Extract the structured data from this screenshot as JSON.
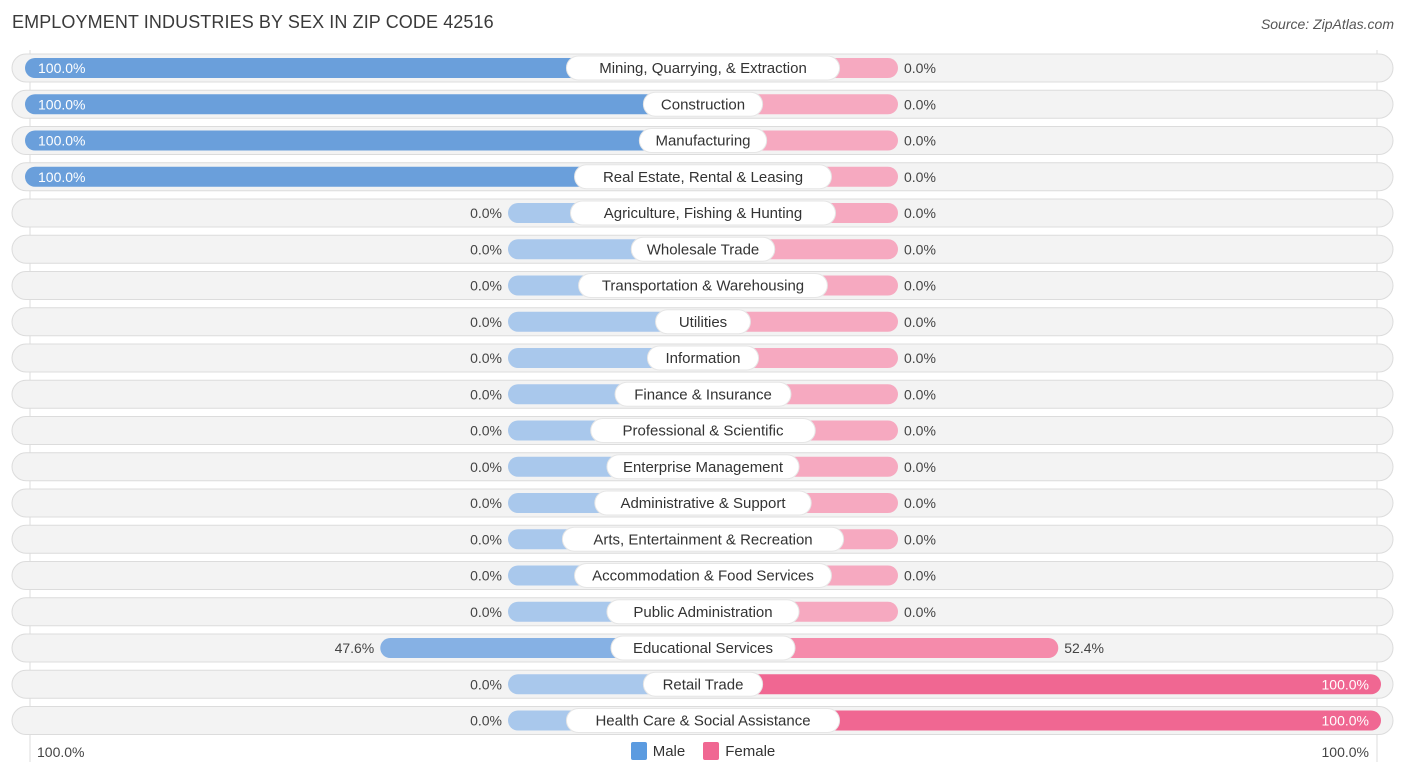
{
  "header": {
    "title": "EMPLOYMENT INDUSTRIES BY SEX IN ZIP CODE 42516",
    "source": "Source: ZipAtlas.com"
  },
  "axis": {
    "left_label": "100.0%",
    "right_label": "100.0%"
  },
  "legend": {
    "items": [
      {
        "label": "Male",
        "color": "#5b9be0"
      },
      {
        "label": "Female",
        "color": "#f06792"
      }
    ]
  },
  "colors": {
    "male_strong": "#6a9fdb",
    "male_mid": "#86b1e4",
    "male_light": "#a9c8ec",
    "female_strong": "#f06792",
    "female_mid": "#f58bab",
    "female_light": "#f6a9c0",
    "row_bg": "#f3f3f3",
    "row_border": "#dcdcdc"
  },
  "chart_data": {
    "type": "bar",
    "orientation": "horizontal-diverging",
    "title": "EMPLOYMENT INDUSTRIES BY SEX IN ZIP CODE 42516",
    "xlabel": "",
    "ylabel": "",
    "xlim": [
      -100,
      100
    ],
    "legend_position": "bottom-center",
    "categories": [
      "Mining, Quarrying, & Extraction",
      "Construction",
      "Manufacturing",
      "Real Estate, Rental & Leasing",
      "Agriculture, Fishing & Hunting",
      "Wholesale Trade",
      "Transportation & Warehousing",
      "Utilities",
      "Information",
      "Finance & Insurance",
      "Professional & Scientific",
      "Enterprise Management",
      "Administrative & Support",
      "Arts, Entertainment & Recreation",
      "Accommodation & Food Services",
      "Public Administration",
      "Educational Services",
      "Retail Trade",
      "Health Care & Social Assistance"
    ],
    "series": [
      {
        "name": "Male",
        "values": [
          100.0,
          100.0,
          100.0,
          100.0,
          0.0,
          0.0,
          0.0,
          0.0,
          0.0,
          0.0,
          0.0,
          0.0,
          0.0,
          0.0,
          0.0,
          0.0,
          47.6,
          0.0,
          0.0
        ],
        "labels": [
          "100.0%",
          "100.0%",
          "100.0%",
          "100.0%",
          "0.0%",
          "0.0%",
          "0.0%",
          "0.0%",
          "0.0%",
          "0.0%",
          "0.0%",
          "0.0%",
          "0.0%",
          "0.0%",
          "0.0%",
          "0.0%",
          "47.6%",
          "0.0%",
          "0.0%"
        ]
      },
      {
        "name": "Female",
        "values": [
          0.0,
          0.0,
          0.0,
          0.0,
          0.0,
          0.0,
          0.0,
          0.0,
          0.0,
          0.0,
          0.0,
          0.0,
          0.0,
          0.0,
          0.0,
          0.0,
          52.4,
          100.0,
          100.0
        ],
        "labels": [
          "0.0%",
          "0.0%",
          "0.0%",
          "0.0%",
          "0.0%",
          "0.0%",
          "0.0%",
          "0.0%",
          "0.0%",
          "0.0%",
          "0.0%",
          "0.0%",
          "0.0%",
          "0.0%",
          "0.0%",
          "0.0%",
          "52.4%",
          "100.0%",
          "100.0%"
        ]
      }
    ]
  }
}
